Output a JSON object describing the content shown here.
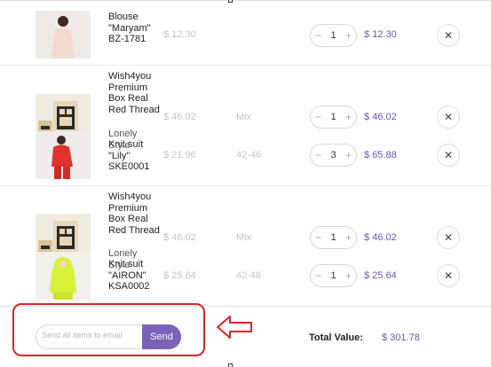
{
  "colors": {
    "accent": "#7b62b8",
    "price_total": "#6a56b0",
    "muted": "#c4c4c4",
    "annotation": "#d8262a"
  },
  "cart": {
    "items": [
      {
        "name": "Blouse \"Maryam\" BZ-1781",
        "unit_price": "$ 12.30",
        "size": "",
        "qty_minus": "−",
        "qty": "1",
        "qty_plus": "+",
        "total": "$ 12.30",
        "remove_icon": "✕"
      },
      {
        "name": "Wish4you Premium Box Real Red Thread",
        "unit_price": "$ 46.02",
        "size": "Mix",
        "qty_minus": "−",
        "qty": "1",
        "qty_plus": "+",
        "total": "$ 46.02",
        "remove_icon": "✕"
      },
      {
        "name": "Knit suit \"Lily\" SKE0001",
        "overlay": "Lonely Style",
        "unit_price": "$ 21.96",
        "size": "42-46",
        "qty_minus": "−",
        "qty": "3",
        "qty_plus": "+",
        "total": "$ 65.88",
        "remove_icon": "✕"
      },
      {
        "name": "Wish4you Premium Box Real Red Thread",
        "unit_price": "$ 46.02",
        "size": "Mix",
        "qty_minus": "−",
        "qty": "1",
        "qty_plus": "+",
        "total": "$ 46.02",
        "remove_icon": "✕"
      },
      {
        "name": "Knit suit \"AIRON\" KSA0002",
        "overlay": "Lonely Style",
        "unit_price": "$ 25.64",
        "size": "42-48",
        "qty_minus": "−",
        "qty": "1",
        "qty_plus": "+",
        "total": "$ 25.64",
        "remove_icon": "✕"
      }
    ]
  },
  "footer": {
    "email_placeholder": "Send all items to email",
    "send_label": "Send",
    "total_label": "Total Value:",
    "total_value": "$ 301.78"
  }
}
